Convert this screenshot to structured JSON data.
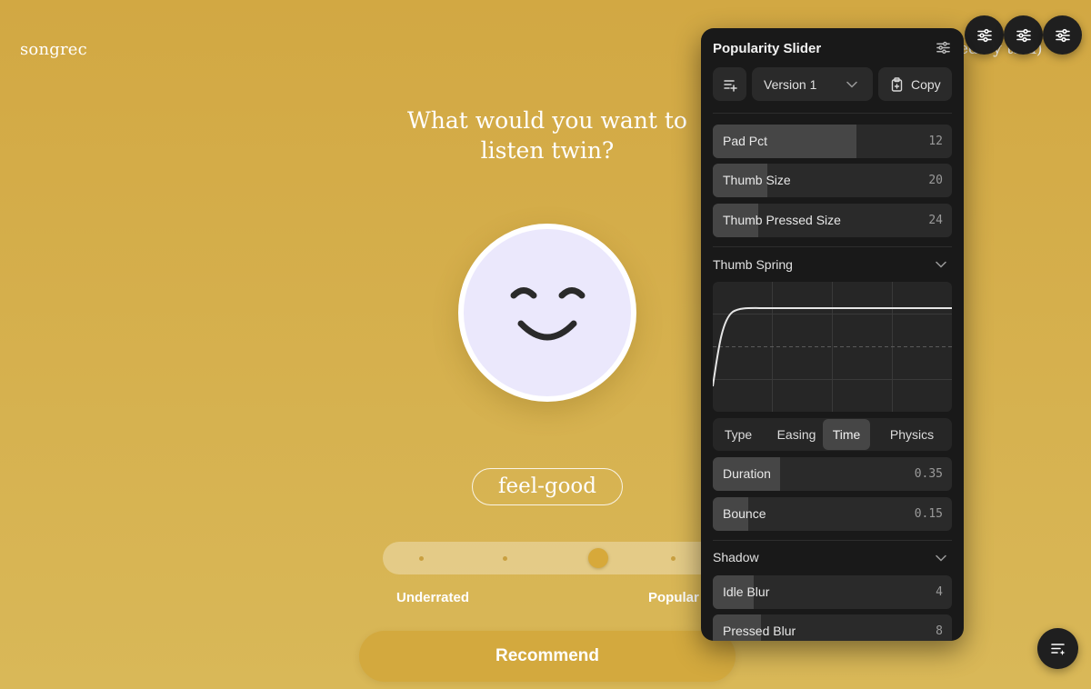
{
  "app": {
    "brand": "songrec",
    "byline": "rted by taki)",
    "question": "What would you want to listen twin?",
    "mood_tag": "feel-good",
    "slider": {
      "left_label": "Underrated",
      "right_label": "Popular",
      "position_fraction": 0.64
    },
    "recommend_label": "Recommend"
  },
  "floating_buttons": {
    "top": [
      "sliders-icon",
      "sliders-icon",
      "sliders-icon"
    ],
    "bottom": "list-sparkle-icon"
  },
  "panel": {
    "title": "Popularity Slider",
    "version_select": "Version 1",
    "copy_label": "Copy",
    "top_sliders": [
      {
        "label": "Pad Pct",
        "value": "12",
        "fill": 0.6
      },
      {
        "label": "Thumb Size",
        "value": "20",
        "fill": 0.23
      },
      {
        "label": "Thumb Pressed Size",
        "value": "24",
        "fill": 0.19
      }
    ],
    "thumb_spring": {
      "title": "Thumb Spring",
      "tabs": [
        "Type",
        "Easing",
        "Time",
        "Physics"
      ],
      "active_tab": "Time",
      "sliders": [
        {
          "label": "Duration",
          "value": "0.35",
          "fill": 0.28
        },
        {
          "label": "Bounce",
          "value": "0.15",
          "fill": 0.15
        }
      ]
    },
    "shadow": {
      "title": "Shadow",
      "sliders": [
        {
          "label": "Idle Blur",
          "value": "4",
          "fill": 0.17
        },
        {
          "label": "Pressed Blur",
          "value": "8",
          "fill": 0.2
        }
      ]
    }
  },
  "colors": {
    "background": "#d2a843",
    "accent": "#d3a93e",
    "panel": "#191919",
    "face": "#ebe8fc"
  }
}
